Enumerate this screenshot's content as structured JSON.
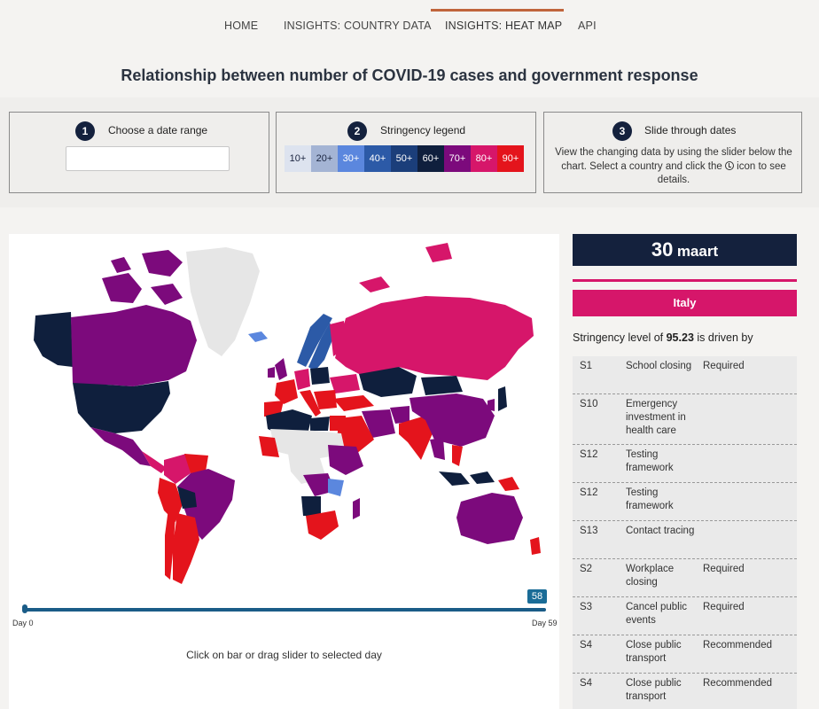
{
  "nav": {
    "items": [
      "HOME",
      "INSIGHTS: COUNTRY DATA",
      "INSIGHTS: HEAT MAP",
      "API"
    ],
    "active_index": 2
  },
  "page_title": "Relationship between number of COVID-19 cases and government response",
  "controls": {
    "date_range": {
      "step": "1",
      "title": "Choose a date range",
      "value": ""
    },
    "stringency": {
      "step": "2",
      "title": "Stringency legend",
      "levels": [
        {
          "label": "10+",
          "color": "#dde3ef",
          "text_color": "#1b2540"
        },
        {
          "label": "20+",
          "color": "#a4b4d4",
          "text_color": "#1b2540"
        },
        {
          "label": "30+",
          "color": "#5b87de",
          "text_color": "#ffffff"
        },
        {
          "label": "40+",
          "color": "#2c5aa7",
          "text_color": "#ffffff"
        },
        {
          "label": "50+",
          "color": "#1b3e7a",
          "text_color": "#ffffff"
        },
        {
          "label": "60+",
          "color": "#0f1f3d",
          "text_color": "#ffffff"
        },
        {
          "label": "70+",
          "color": "#7c0a7c",
          "text_color": "#ffffff"
        },
        {
          "label": "80+",
          "color": "#d6166a",
          "text_color": "#ffffff"
        },
        {
          "label": "90+",
          "color": "#e4141c",
          "text_color": "#ffffff"
        }
      ]
    },
    "slide": {
      "step": "3",
      "title": "Slide through dates",
      "text_before": "View the changing data by using the slider below the chart. Select a country and click the ",
      "icon": "clock-history-icon",
      "text_after": " icon to see details."
    }
  },
  "slider": {
    "value": "58",
    "value_fraction": 0.983,
    "start_label": "Day 0",
    "end_label": "Day 59",
    "hint": "Click on bar or drag slider to selected day"
  },
  "detail": {
    "day": "30",
    "month": "maart",
    "country": "Italy",
    "driven_prefix": "Stringency level of ",
    "stringency_value": "95.23",
    "driven_suffix": " is driven by",
    "policies": [
      {
        "code": "S1",
        "name": "School closing",
        "level": "Required"
      },
      {
        "code": "S10",
        "name": "Emergency investment in health care",
        "level": ""
      },
      {
        "code": "S12",
        "name": "Testing framework",
        "level": ""
      },
      {
        "code": "S12",
        "name": "Testing framework",
        "level": ""
      },
      {
        "code": "S13",
        "name": "Contact tracing",
        "level": ""
      },
      {
        "code": "S2",
        "name": "Workplace closing",
        "level": "Required"
      },
      {
        "code": "S3",
        "name": "Cancel public events",
        "level": "Required"
      },
      {
        "code": "S4",
        "name": "Close public transport",
        "level": "Recommended"
      },
      {
        "code": "S4",
        "name": "Close public transport",
        "level": "Recommended"
      }
    ]
  },
  "map_colors": {
    "no_data": "#e6e6e6",
    "purple": "#7c0a7c",
    "magenta": "#d6166a",
    "red": "#e4141c",
    "navy": "#0f1f3d",
    "blue": "#2c5aa7",
    "light_blue": "#5b87de"
  }
}
